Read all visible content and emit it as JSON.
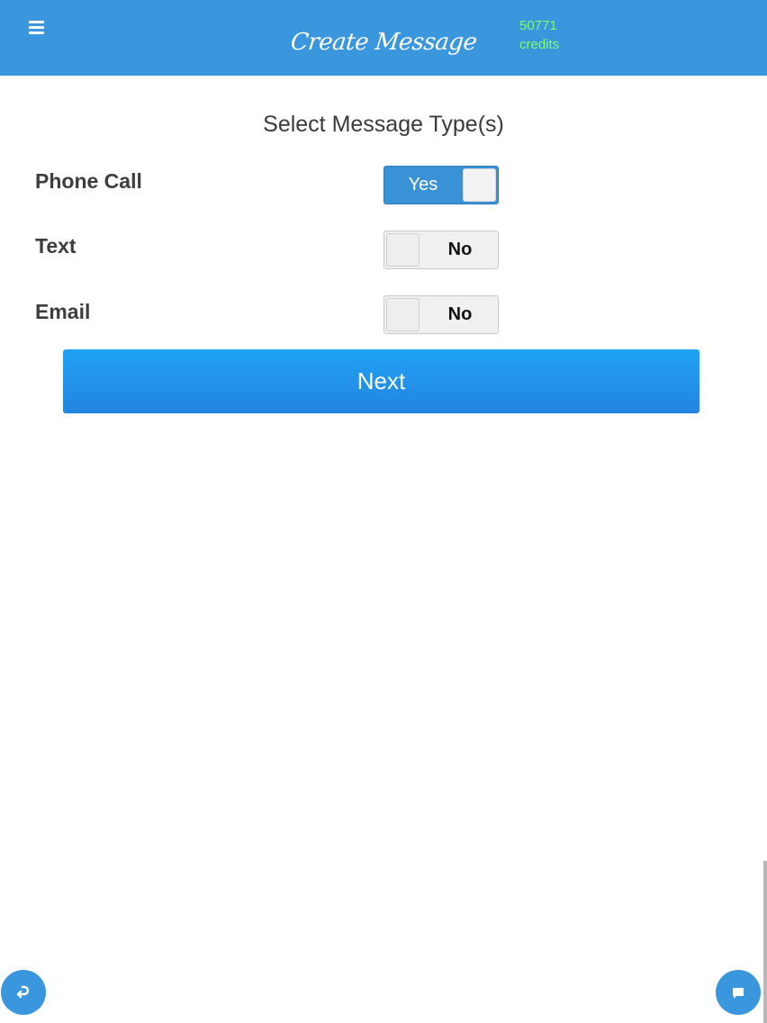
{
  "header": {
    "title": "Create Message",
    "credits_value": "50771",
    "credits_label": "credits",
    "menu_icon": "hamburger-menu-icon"
  },
  "form": {
    "heading": "Select Message Type(s)",
    "rows": [
      {
        "label": "Phone Call",
        "state": "Yes",
        "enabled": true
      },
      {
        "label": "Text",
        "state": "No",
        "enabled": false
      },
      {
        "label": "Email",
        "state": "No",
        "enabled": false
      }
    ],
    "next_label": "Next"
  },
  "footer": {
    "back_icon": "undo-arrow-icon",
    "chat_icon": "chat-bubble-icon"
  },
  "colors": {
    "header": "#3a96dd",
    "credits": "#7dff6e",
    "toggle_on": "#3a92d6",
    "button": "#2196f3"
  }
}
